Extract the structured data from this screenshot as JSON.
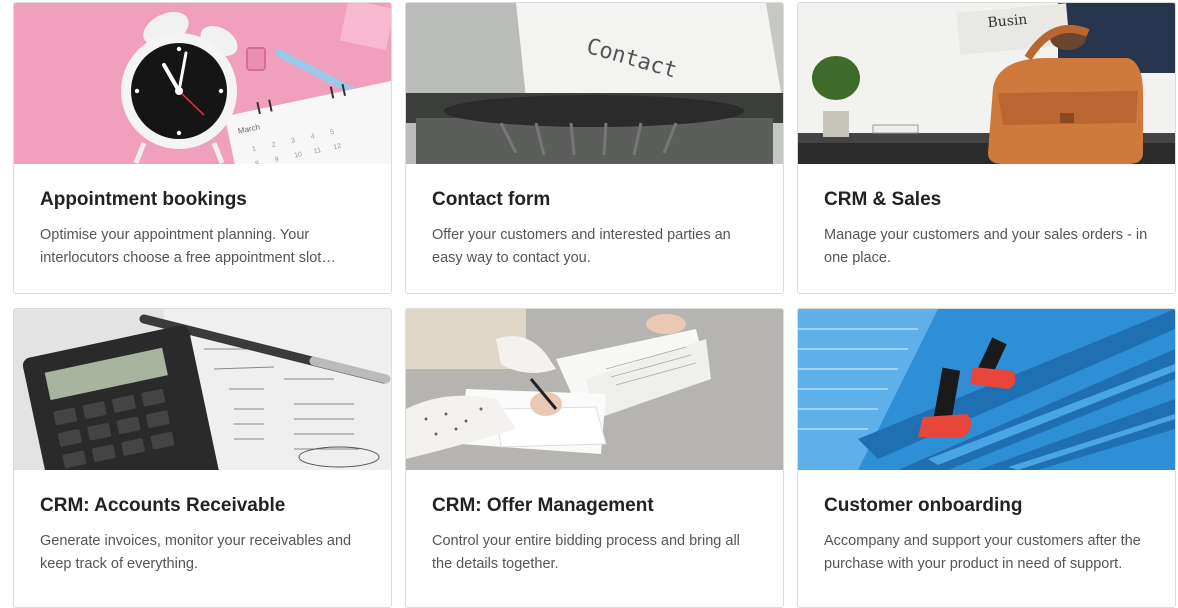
{
  "cards": [
    {
      "title": "Appointment bookings",
      "description": "Optimise your appointment planning. Your interlocutors choose a free appointment slot online.",
      "image": "alarm-clock-calendar-photo",
      "accent": "#f4a3c0"
    },
    {
      "title": "Contact form",
      "description": "Offer your customers and interested parties an easy way to contact you.",
      "image": "typewriter-photo",
      "image_text": "Contact",
      "accent": "#c9cbc7"
    },
    {
      "title": "CRM & Sales",
      "description": "Manage your customers and your sales orders - in one place.",
      "image": "leather-bag-newspaper-photo",
      "accent": "#d7742f"
    },
    {
      "title": "CRM: Accounts Receivable",
      "description": "Generate invoices, monitor your receivables and keep track of everything.",
      "image": "calculator-pen-photo",
      "accent": "#d9d9d9"
    },
    {
      "title": "CRM: Offer Management",
      "description": "Control your entire bidding process and bring all the details together.",
      "image": "signing-documents-photo",
      "accent": "#b9b8b4"
    },
    {
      "title": "Customer onboarding",
      "description": "Accompany and support your customers after the purchase with your product in need of support.",
      "image": "blue-stairs-red-shoes-photo",
      "accent": "#2f8fd6"
    }
  ]
}
